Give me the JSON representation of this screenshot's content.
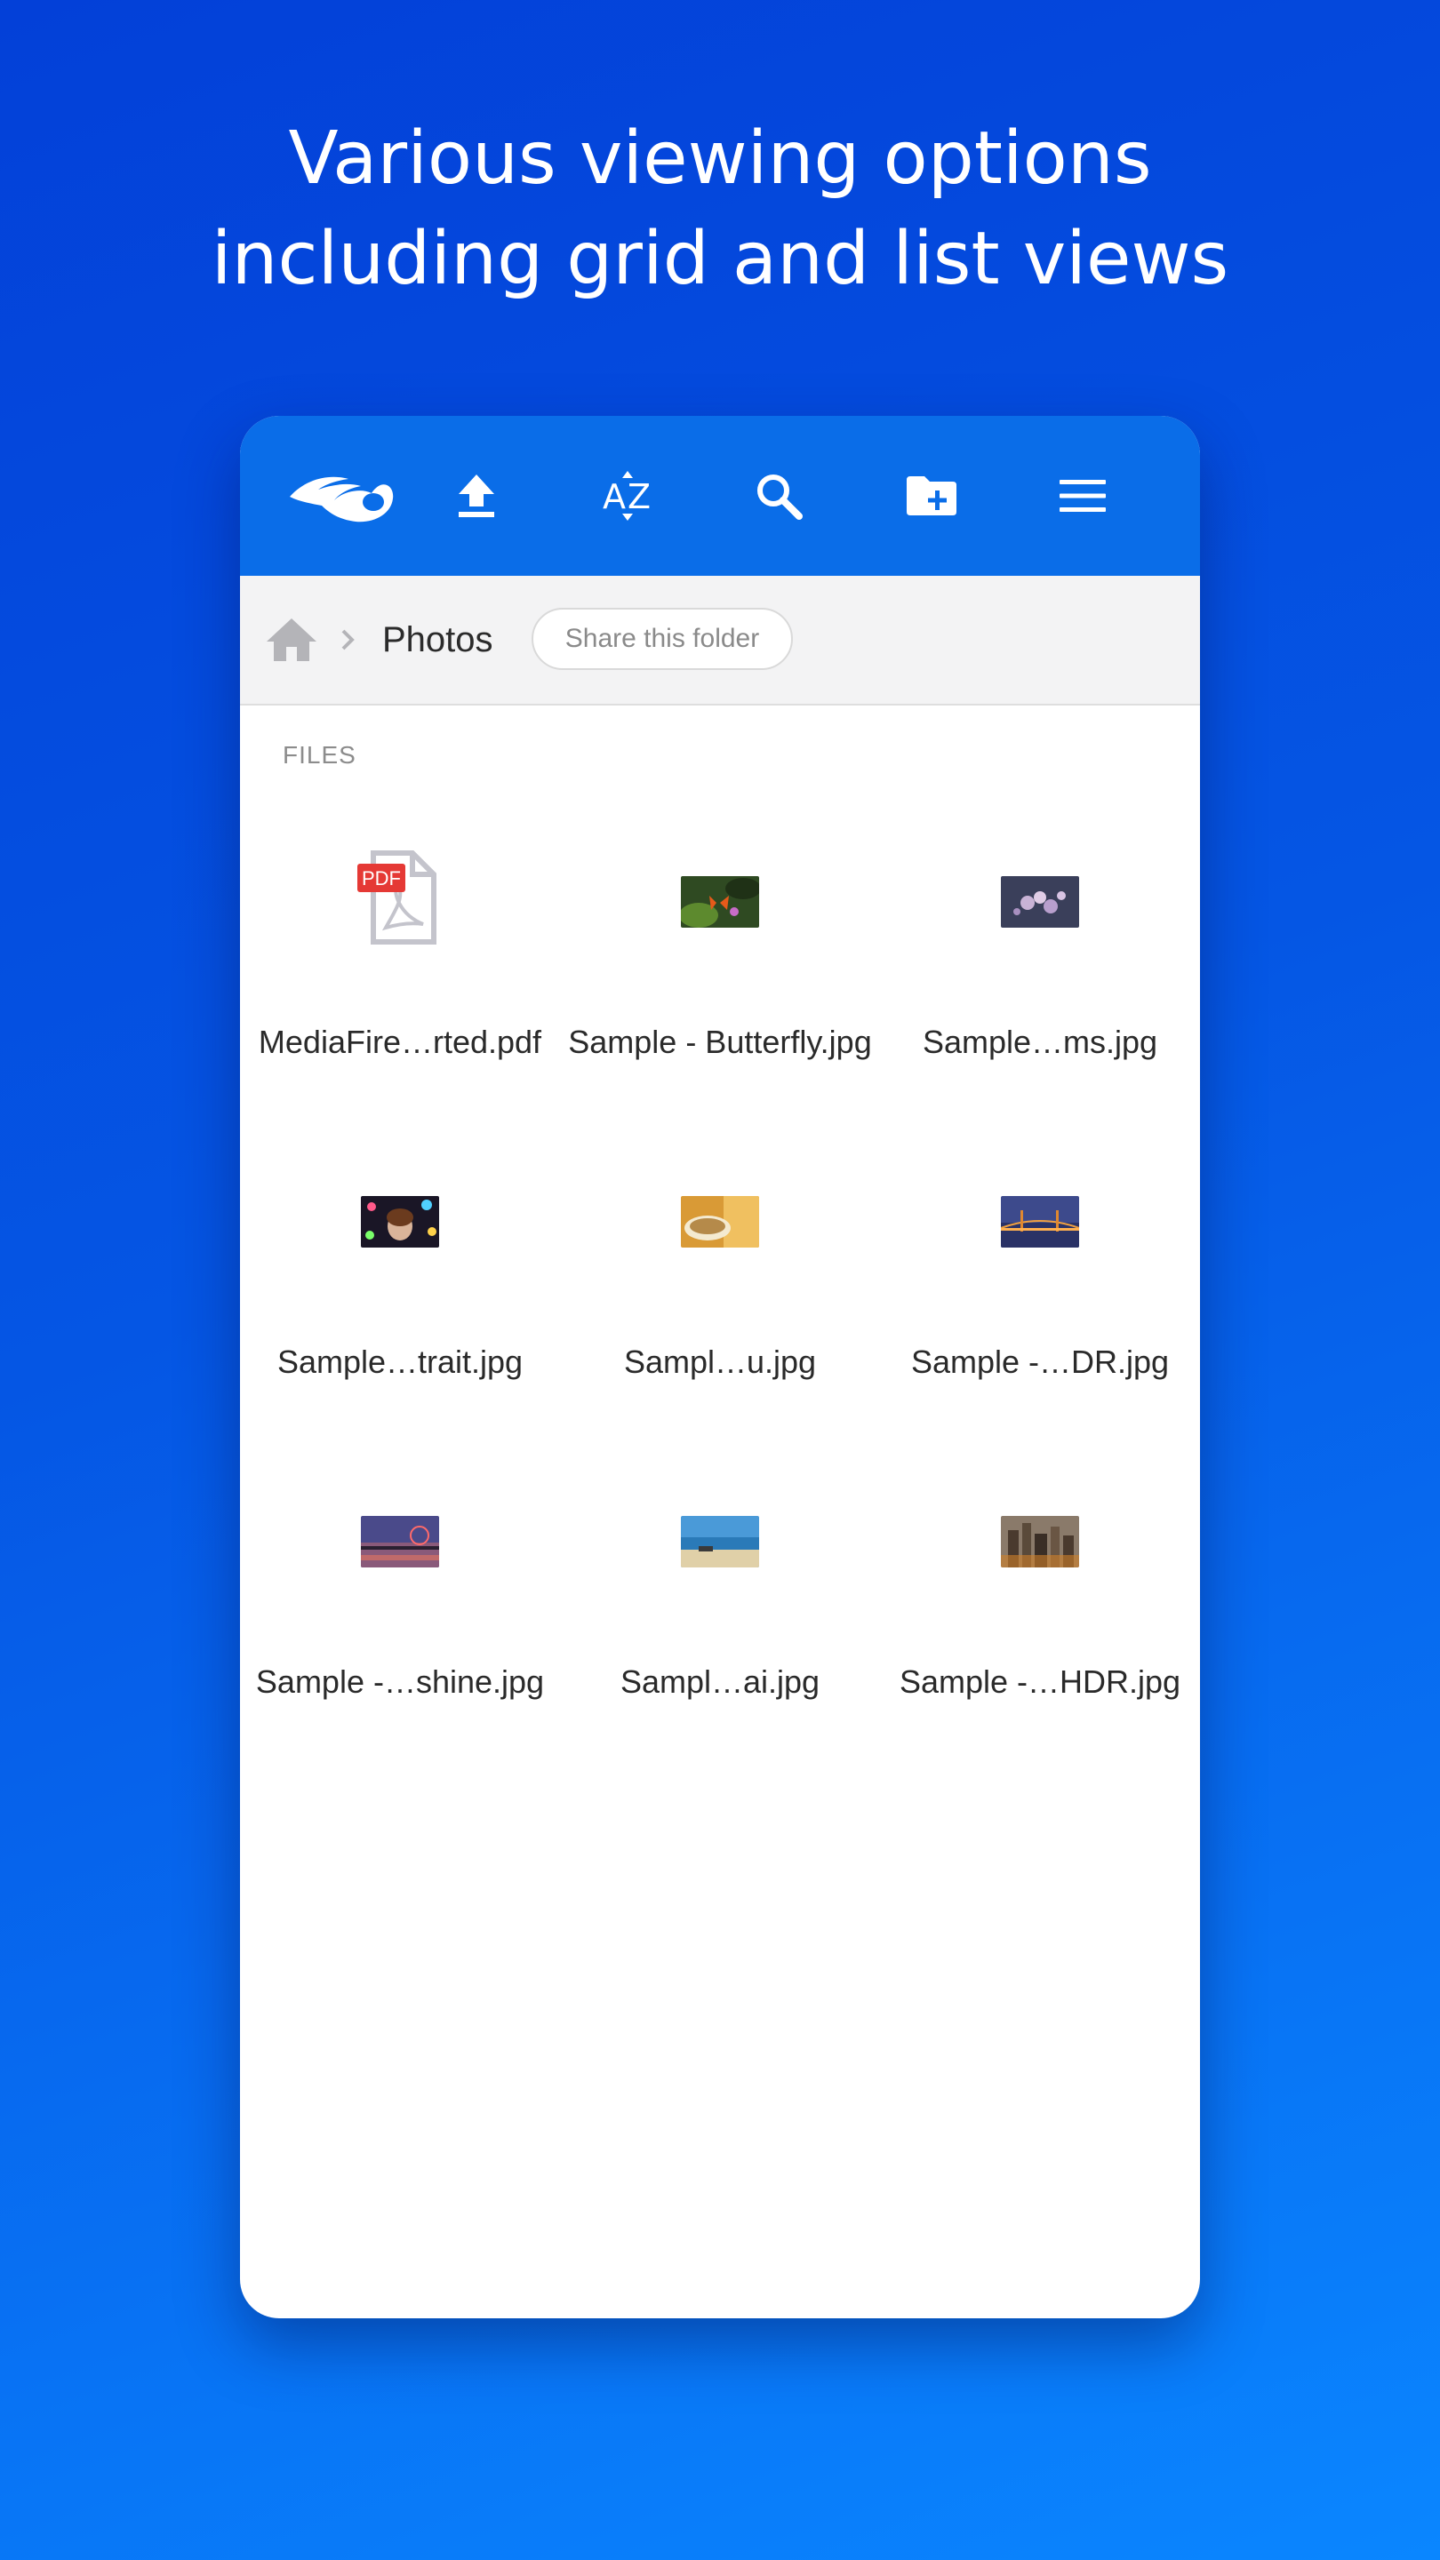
{
  "headline": {
    "line1": "Various viewing options",
    "line2": "including grid and list views"
  },
  "colors": {
    "background_top": "#0340d8",
    "background_bottom": "#0a86ff",
    "toolbar": "#0a6de8",
    "breadcrumb_bg": "#f3f3f4",
    "pdf_badge": "#e53935"
  },
  "toolbar": {
    "icons": [
      "mediafire-logo-icon",
      "upload-icon",
      "sort-az-icon",
      "search-icon",
      "new-folder-icon",
      "menu-icon"
    ]
  },
  "breadcrumb": {
    "home_icon": "home-icon",
    "separator_icon": "chevron-right-icon",
    "current_folder": "Photos",
    "share_label": "Share this folder"
  },
  "files_section": {
    "label": "FILES",
    "items": [
      {
        "name": "MediaFire…rted.pdf",
        "type": "pdf",
        "badge": "PDF"
      },
      {
        "name": "Sample - Butterfly.jpg",
        "type": "image",
        "thumb": "butterfly"
      },
      {
        "name": "Sample…ms.jpg",
        "type": "image",
        "thumb": "blossoms"
      },
      {
        "name": "Sample…trait.jpg",
        "type": "image",
        "thumb": "portrait"
      },
      {
        "name": "Sampl…u.jpg",
        "type": "image",
        "thumb": "coffee"
      },
      {
        "name": "Sample -…DR.jpg",
        "type": "image",
        "thumb": "bridge"
      },
      {
        "name": "Sample -…shine.jpg",
        "type": "image",
        "thumb": "ferris"
      },
      {
        "name": "Sampl…ai.jpg",
        "type": "image",
        "thumb": "beach"
      },
      {
        "name": "Sample -…HDR.jpg",
        "type": "image",
        "thumb": "city"
      }
    ]
  }
}
